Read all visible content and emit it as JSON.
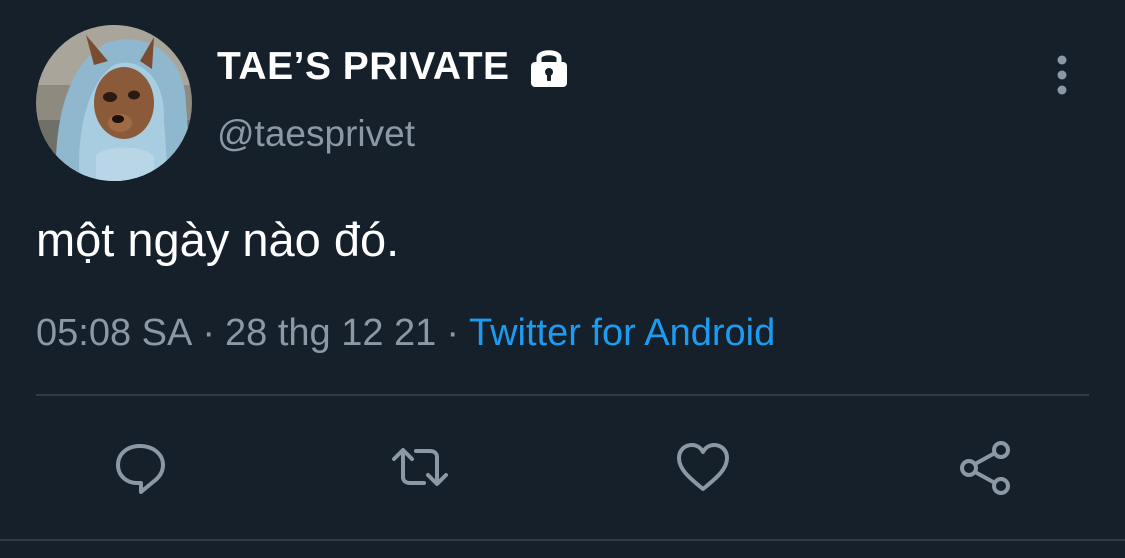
{
  "user": {
    "display_name": "TAE’S PRIVATE",
    "handle": "@taesprivet",
    "avatar_icon": "dog-in-hoodie-avatar",
    "protected_icon": "lock-icon"
  },
  "tweet": {
    "text": "một ngày nào đó.",
    "time": "05:08 SA",
    "separator": "·",
    "date": "28 thg 12 21",
    "source": "Twitter for Android"
  },
  "actions": {
    "reply_icon": "reply-icon",
    "retweet_icon": "retweet-icon",
    "like_icon": "heart-icon",
    "share_icon": "share-icon",
    "more_icon": "more-vertical-icon"
  },
  "colors": {
    "background": "#15202b",
    "text": "#ffffff",
    "secondary": "#8b98a5",
    "link": "#1d9bf0",
    "divider": "#2f3b47"
  }
}
